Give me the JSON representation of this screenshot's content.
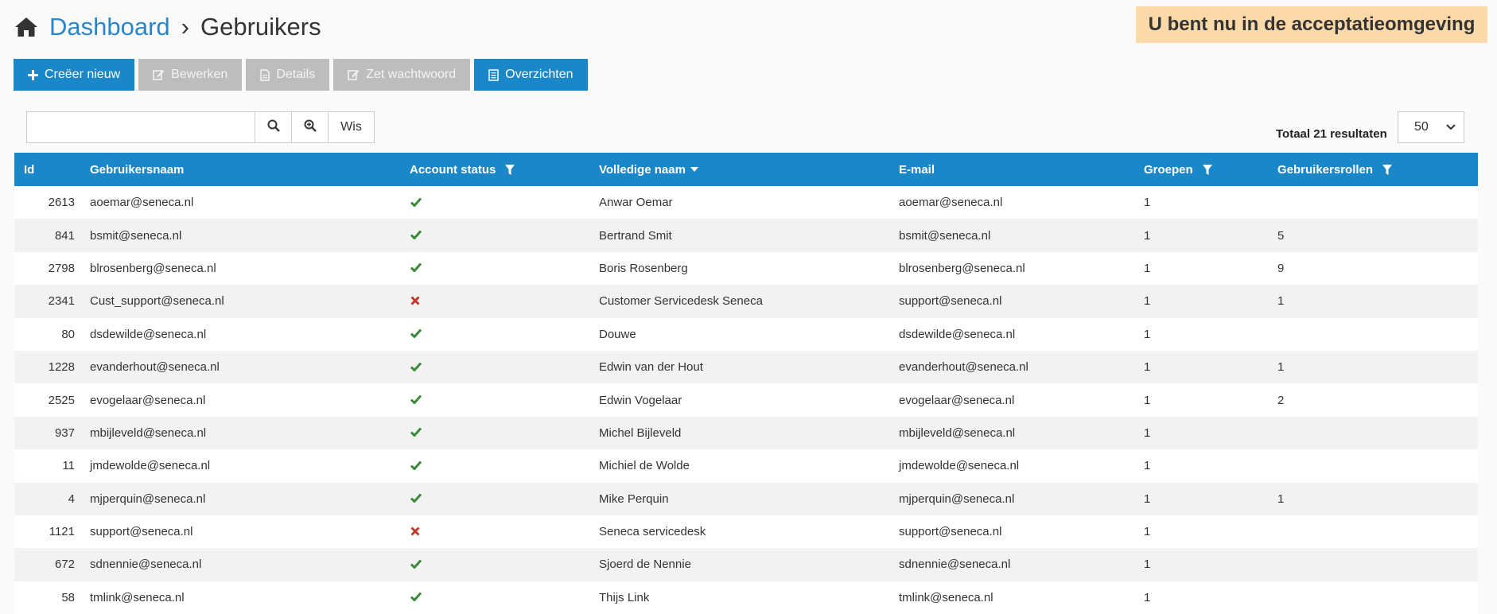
{
  "breadcrumb": {
    "home": "Dashboard",
    "separator": "›",
    "current": "Gebruikers"
  },
  "environment_banner": "U bent nu in de acceptatieomgeving",
  "toolbar": {
    "create": "Creëer nieuw",
    "edit": "Bewerken",
    "details": "Details",
    "password": "Zet wachtwoord",
    "overviews": "Overzichten"
  },
  "search": {
    "value": "",
    "placeholder": "",
    "clear_label": "Wis"
  },
  "total_label": "Totaal 21 resultaten",
  "page_size": "50",
  "table": {
    "headers": {
      "id": "Id",
      "username": "Gebruikersnaam",
      "status": "Account status",
      "fullname": "Volledige naam",
      "email": "E-mail",
      "groups": "Groepen",
      "roles": "Gebruikersrollen"
    },
    "rows": [
      {
        "id": "2613",
        "username": "aoemar@seneca.nl",
        "active": true,
        "fullname": "Anwar Oemar",
        "email": "aoemar@seneca.nl",
        "groups": "1",
        "roles": ""
      },
      {
        "id": "841",
        "username": "bsmit@seneca.nl",
        "active": true,
        "fullname": "Bertrand Smit",
        "email": "bsmit@seneca.nl",
        "groups": "1",
        "roles": "5"
      },
      {
        "id": "2798",
        "username": "blrosenberg@seneca.nl",
        "active": true,
        "fullname": "Boris Rosenberg",
        "email": "blrosenberg@seneca.nl",
        "groups": "1",
        "roles": "9"
      },
      {
        "id": "2341",
        "username": "Cust_support@seneca.nl",
        "active": false,
        "fullname": "Customer Servicedesk Seneca",
        "email": "support@seneca.nl",
        "groups": "1",
        "roles": "1"
      },
      {
        "id": "80",
        "username": "dsdewilde@seneca.nl",
        "active": true,
        "fullname": "Douwe",
        "email": "dsdewilde@seneca.nl",
        "groups": "1",
        "roles": ""
      },
      {
        "id": "1228",
        "username": "evanderhout@seneca.nl",
        "active": true,
        "fullname": "Edwin van der Hout",
        "email": "evanderhout@seneca.nl",
        "groups": "1",
        "roles": "1"
      },
      {
        "id": "2525",
        "username": "evogelaar@seneca.nl",
        "active": true,
        "fullname": "Edwin Vogelaar",
        "email": "evogelaar@seneca.nl",
        "groups": "1",
        "roles": "2"
      },
      {
        "id": "937",
        "username": "mbijleveld@seneca.nl",
        "active": true,
        "fullname": "Michel Bijleveld",
        "email": "mbijleveld@seneca.nl",
        "groups": "1",
        "roles": ""
      },
      {
        "id": "11",
        "username": "jmdewolde@seneca.nl",
        "active": true,
        "fullname": "Michiel de Wolde",
        "email": "jmdewolde@seneca.nl",
        "groups": "1",
        "roles": ""
      },
      {
        "id": "4",
        "username": "mjperquin@seneca.nl",
        "active": true,
        "fullname": "Mike Perquin",
        "email": "mjperquin@seneca.nl",
        "groups": "1",
        "roles": "1"
      },
      {
        "id": "1121",
        "username": "support@seneca.nl",
        "active": false,
        "fullname": "Seneca servicedesk",
        "email": "support@seneca.nl",
        "groups": "1",
        "roles": ""
      },
      {
        "id": "672",
        "username": "sdnennie@seneca.nl",
        "active": true,
        "fullname": "Sjoerd de Nennie",
        "email": "sdnennie@seneca.nl",
        "groups": "1",
        "roles": ""
      },
      {
        "id": "58",
        "username": "tmlink@seneca.nl",
        "active": true,
        "fullname": "Thijs Link",
        "email": "tmlink@seneca.nl",
        "groups": "1",
        "roles": ""
      }
    ]
  },
  "icons": {
    "home": "home-icon",
    "plus": "plus-icon",
    "edit": "edit-icon",
    "document": "document-icon",
    "search": "search-icon",
    "zoom": "zoom-in-icon",
    "filter": "filter-icon",
    "sort": "sort-down-icon",
    "check": "check-icon",
    "cross": "cross-icon"
  },
  "colors": {
    "primary": "#1a87c9",
    "disabled": "#bdbdbd",
    "banner": "#fbd9a8",
    "check": "#3a8a3a",
    "cross": "#c0392b"
  }
}
